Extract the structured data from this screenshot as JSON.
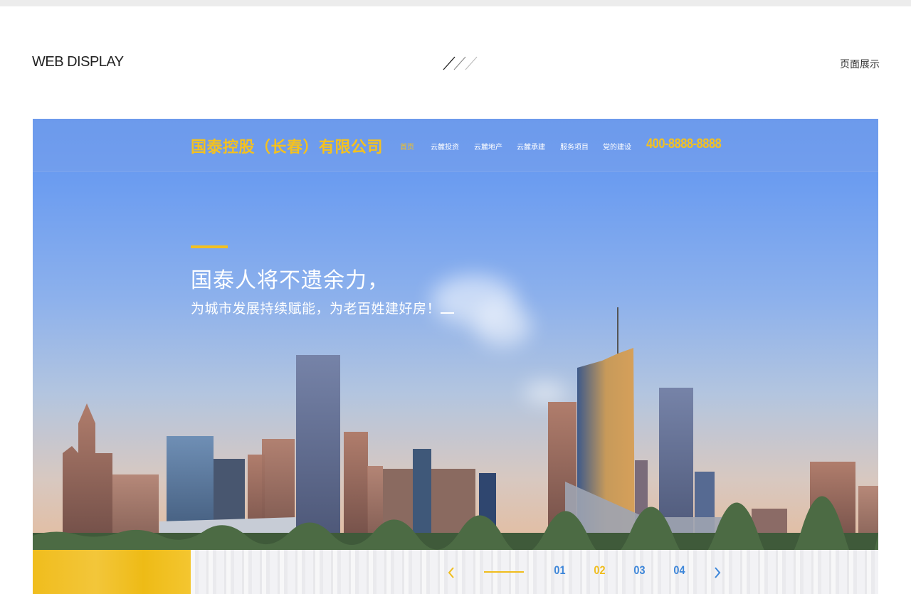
{
  "section": {
    "title_left": "WEB DISPLAY",
    "title_right": "页面展示"
  },
  "site": {
    "logo": "国泰控股（长春）有限公司",
    "nav": [
      "首页",
      "云麓投资",
      "云麓地产",
      "云麓承建",
      "服务项目",
      "党的建设"
    ],
    "active_nav": "首页",
    "phone": "400-8888-8888"
  },
  "hero": {
    "title": "国泰人将不遗余力，",
    "subtitle": "为城市发展持续赋能，为老百姓建好房！"
  },
  "slider": {
    "numbers": [
      "01",
      "02",
      "03",
      "04"
    ],
    "active": "02"
  },
  "colors": {
    "accent": "#f4c11f",
    "link_blue": "#3d86d9"
  },
  "icons": {
    "prev": "chevron-left-icon",
    "next": "chevron-right-icon"
  }
}
